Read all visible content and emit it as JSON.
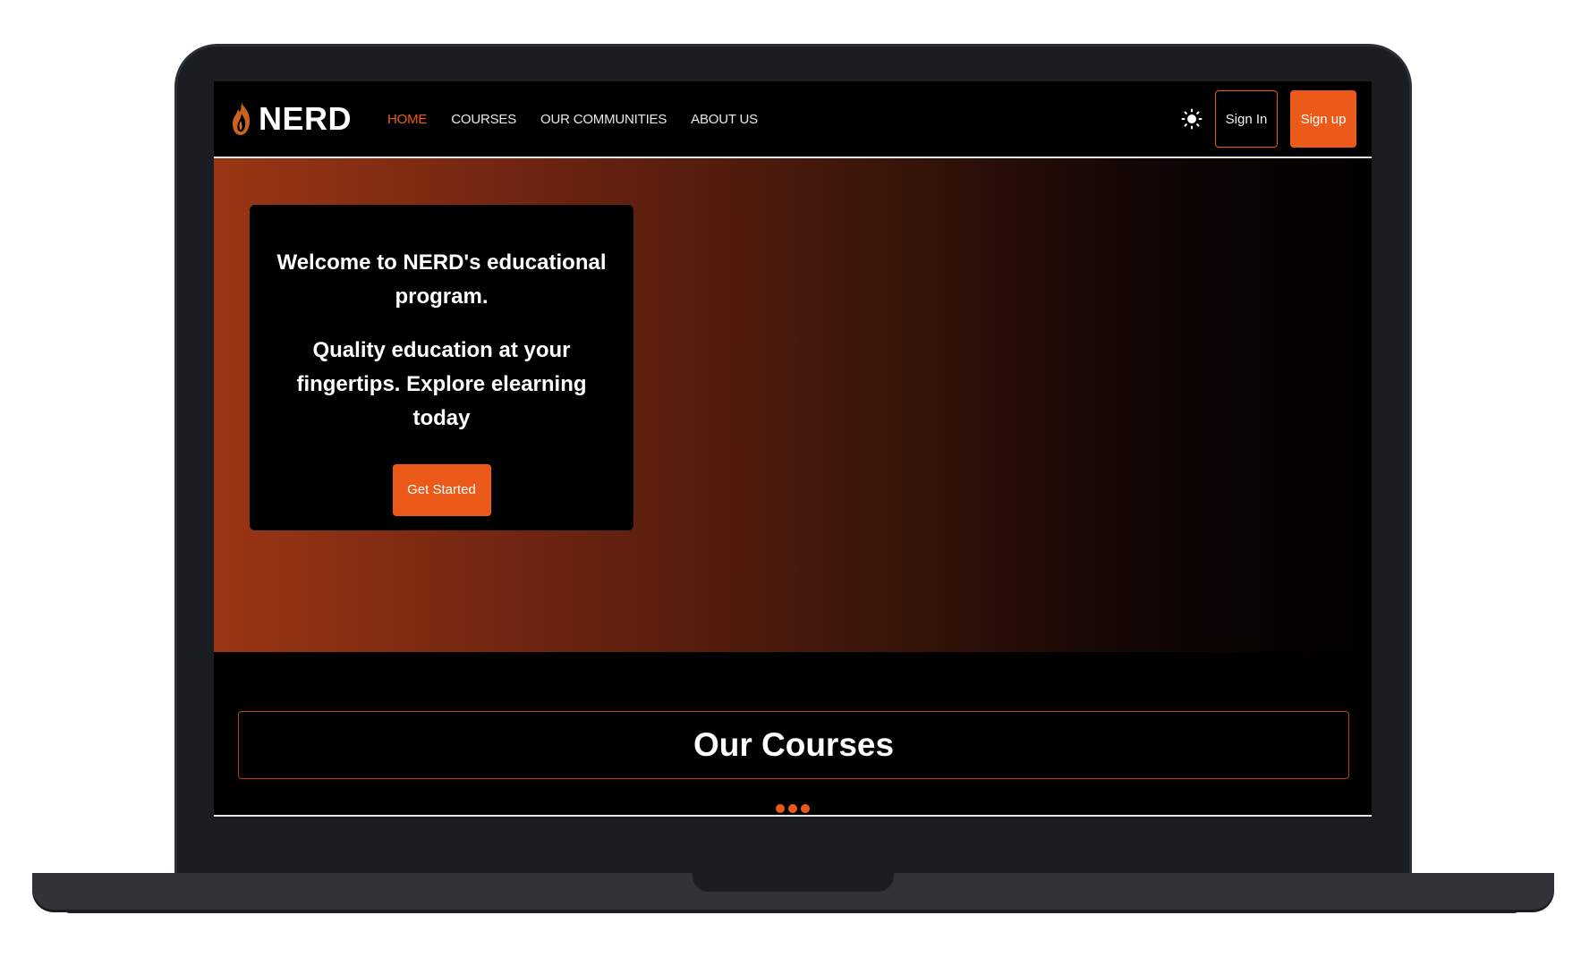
{
  "nav": {
    "brand": "NERD",
    "links": [
      "HOME",
      "COURSES",
      "OUR COMMUNITIES",
      "ABOUT US"
    ],
    "active_link": "HOME",
    "sign_in": "Sign In",
    "sign_up": "Sign up"
  },
  "hero": {
    "title": "Welcome to NERD's educational program.",
    "subtitle": "Quality education at your fingertips. Explore elearning today",
    "cta": "Get Started"
  },
  "courses": {
    "heading": "Our Courses"
  },
  "colors": {
    "accent": "#ec5a1a",
    "background": "#000000",
    "hero_gradient_start": "#9a3615"
  },
  "icons": [
    "flame-logo-icon",
    "sun-icon",
    "loading-dots-icon"
  ]
}
